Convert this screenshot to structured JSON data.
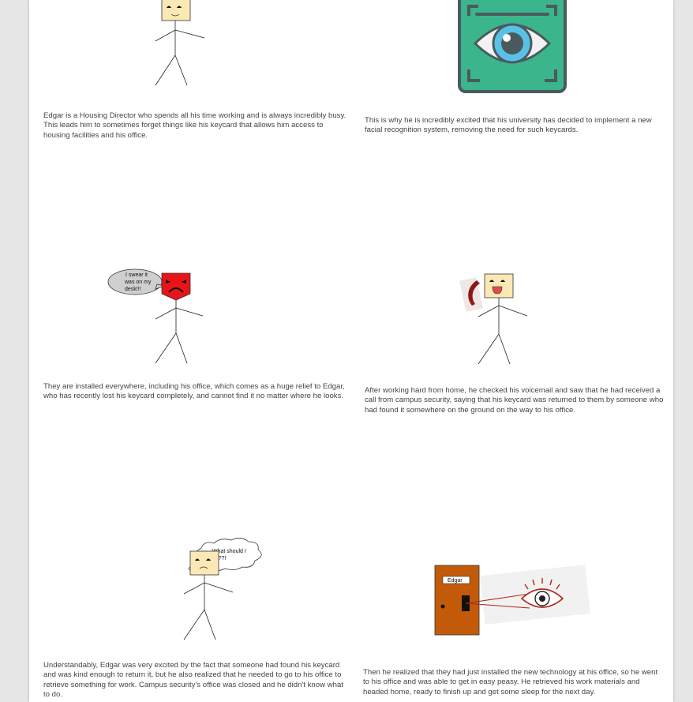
{
  "panels": [
    {
      "caption": "Edgar is a Housing Director who spends all his time working and is always incredibly busy. This leads him to sometimes forget things like his keycard that allows him access to housing facilities and his office."
    },
    {
      "caption": "This is why he is incredibly excited that his university has decided to implement a new facial recognition system, removing the need for such keycards."
    },
    {
      "caption": "They are installed everywhere, including his office, which comes as a huge relief to Edgar, who has recently lost his keycard completely, and cannot find it no matter where he looks.",
      "bubble": [
        "I swear it",
        "was on my",
        "desk!!!"
      ]
    },
    {
      "caption": "After working hard from home, he checked his voicemail and saw that he had received a call from campus security, saying that his keycard was returned to them by someone who had found it somewhere on the ground on the way to his office."
    },
    {
      "caption": "Understandably, Edgar was very excited by the fact that someone had found his keycard and was kind enough to return it, but he also realized that he needed to go to his office to retrieve something for work. Campus security's office was closed and he didn't know what to do.",
      "thought": [
        "What should I",
        "do??!"
      ]
    },
    {
      "caption": "Then he realized that they had just installed the new technology at his office, so he went to his office and was able to get in easy peasy. He retrieved his work materials and headed home, ready to finish up and get some sleep for the next day.",
      "door_label": "Edgar"
    }
  ],
  "colors": {
    "scanner_green": "#3bb58c",
    "scanner_border": "#4b5a5e",
    "angry_face": "#e8141a",
    "face": "#fbe8b4",
    "door": "#c25a0a",
    "eye_red": "#b0241a",
    "phone": "#8b1a14"
  }
}
